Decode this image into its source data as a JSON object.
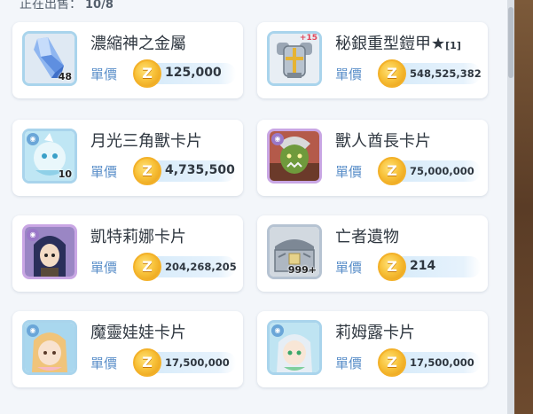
{
  "header": {
    "label": "正在出售：",
    "count": "10/8"
  },
  "common": {
    "price_label": "單價"
  },
  "listings": [
    {
      "name": "濃縮神之金屬",
      "tag": "",
      "price": "125,000",
      "qty": "48",
      "plus": ""
    },
    {
      "name": "秘銀重型鎧甲★",
      "tag": "[1]",
      "price": "548,525,382",
      "qty": "",
      "plus": "+15"
    },
    {
      "name": "月光三角獸卡片",
      "tag": "",
      "price": "4,735,500",
      "qty": "10",
      "plus": ""
    },
    {
      "name": "獸人酋長卡片",
      "tag": "",
      "price": "75,000,000",
      "qty": "",
      "plus": ""
    },
    {
      "name": "凱特莉娜卡片",
      "tag": "",
      "price": "204,268,205",
      "qty": "",
      "plus": ""
    },
    {
      "name": "亡者遺物",
      "tag": "",
      "price": "214",
      "qty": "999+",
      "plus": ""
    },
    {
      "name": "魔靈娃娃卡片",
      "tag": "",
      "price": "17,500,000",
      "qty": "",
      "plus": ""
    },
    {
      "name": "莉姆露卡片",
      "tag": "",
      "price": "17,500,000",
      "qty": "",
      "plus": ""
    }
  ]
}
